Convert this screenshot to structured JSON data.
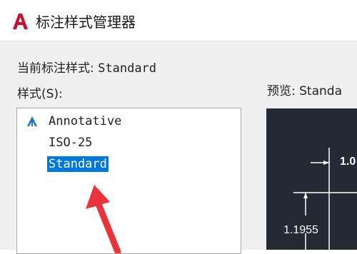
{
  "window": {
    "title": "标注样式管理器",
    "app_icon": "autocad-logo-icon"
  },
  "dialog": {
    "current_style_label": "当前标注样式: ",
    "current_style_value": "Standard",
    "styles_label": "样式(S):",
    "preview_label": "预览: Standa"
  },
  "styles_list": {
    "items": [
      {
        "label": "Annotative",
        "icon": "annotative-icon",
        "selected": false
      },
      {
        "label": "ISO-25",
        "selected": false
      },
      {
        "label": "Standard",
        "selected": true
      }
    ]
  },
  "preview": {
    "dim_top": "1.0",
    "dim_left": "1.1955"
  },
  "colors": {
    "accent": "#0078d7",
    "logo_red": "#c8102e",
    "preview_bg": "#232a33",
    "annotation_arrow": "#e8343a"
  }
}
